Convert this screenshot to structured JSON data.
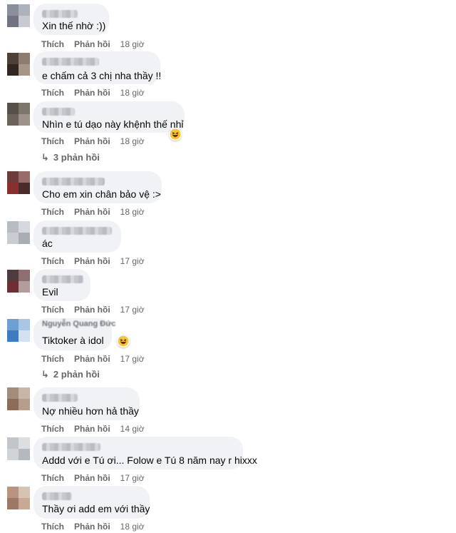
{
  "labels": {
    "like": "Thích",
    "reply": "Phản hồi"
  },
  "comments": [
    {
      "text": "Xin thế nhờ :))",
      "time": "18 giờ"
    },
    {
      "text": "e chấm cả 3 chị nha thầy !!",
      "time": "18 giờ"
    },
    {
      "text": "Nhìn e tú dạo này khệnh thế nhỉ",
      "time": "18 giờ",
      "reaction": "laugh-emoji",
      "replies": "3 phản hồi"
    },
    {
      "text": "Cho em xin chân bảo vệ :>",
      "time": "18 giờ"
    },
    {
      "text": "ác",
      "time": "17 giờ"
    },
    {
      "text": "Evil",
      "time": "17 giờ"
    },
    {
      "text": "Tiktoker à idol",
      "time": "17 giờ",
      "name_partial": "Nguyễn Quang Đức",
      "reaction": "laugh-emoji",
      "replies": "2 phản hồi"
    },
    {
      "text": "Nợ nhiều hơn hả thầy",
      "time": "14 giờ"
    },
    {
      "text": "Addd với e Tú ơi... Folow e Tú 8 năm nay r hixxx",
      "time": "17 giờ"
    },
    {
      "text": "Thầy ơi add em với thầy",
      "time": "18 giờ"
    }
  ],
  "colors": {
    "bubble": "#f0f2f5",
    "meta": "#65676b",
    "text": "#050505"
  }
}
